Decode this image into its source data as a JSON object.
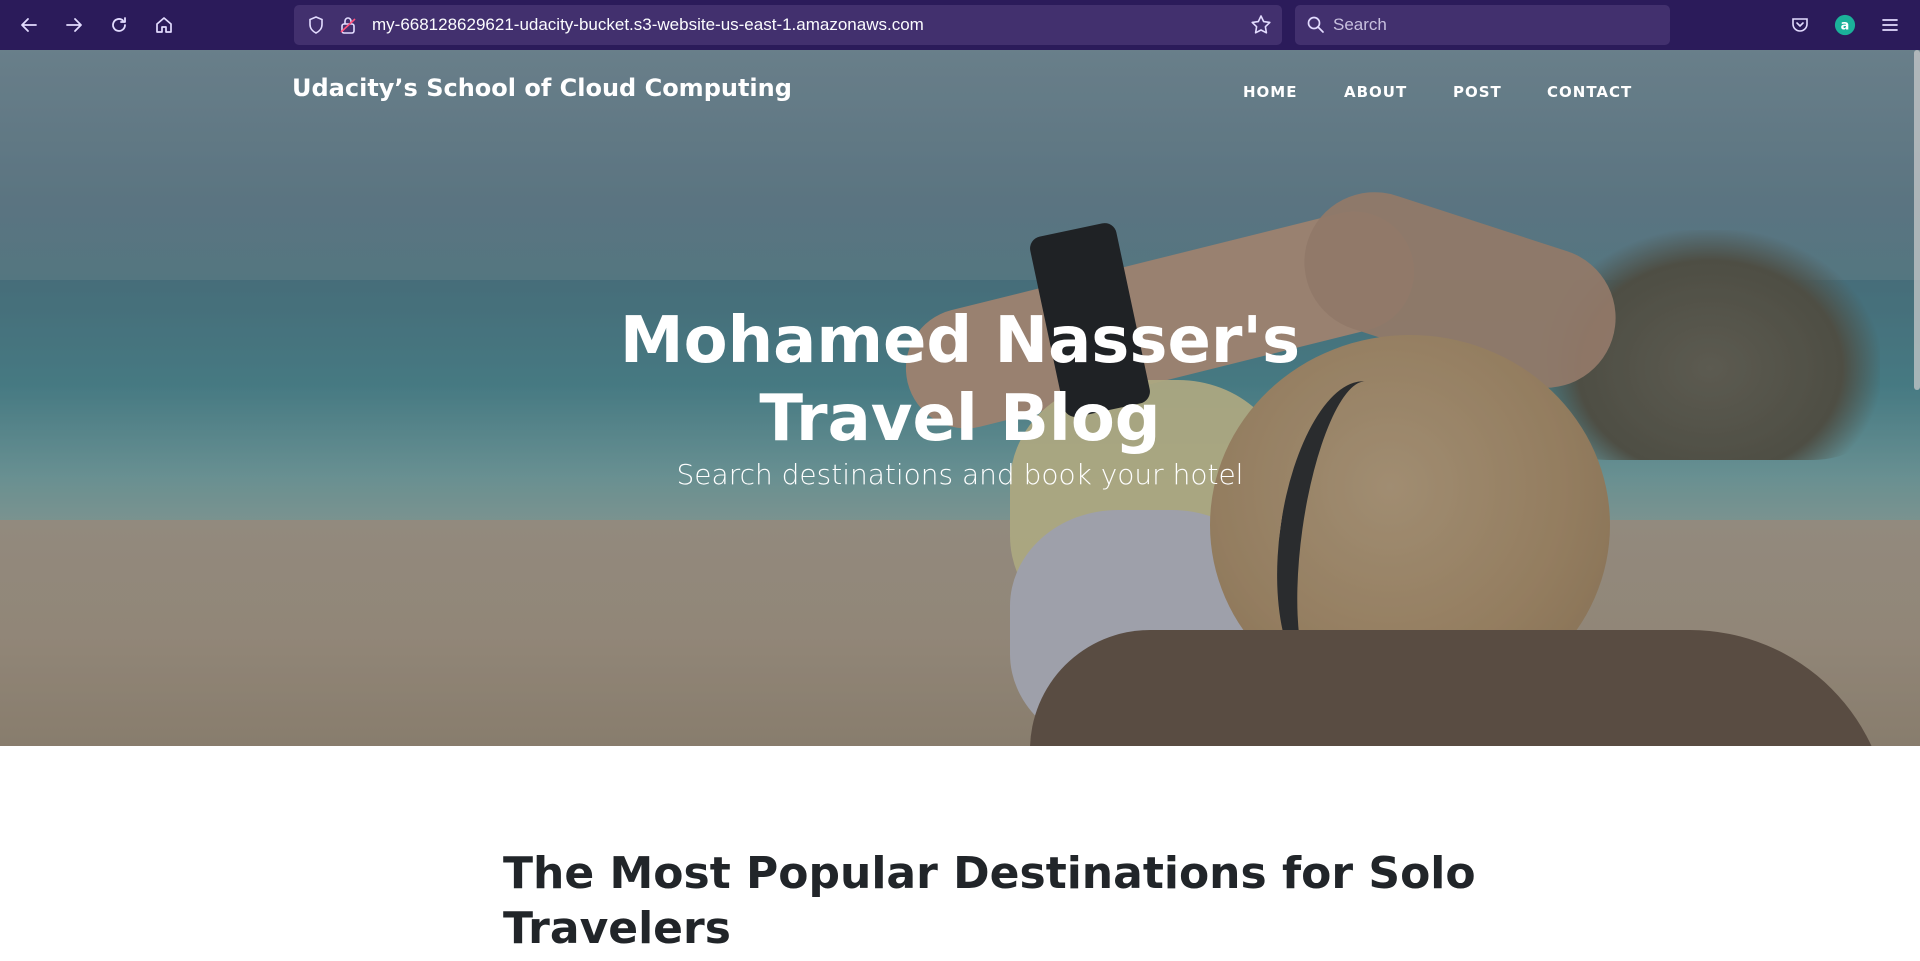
{
  "browser": {
    "url": "my-668128629621-udacity-bucket.s3-website-us-east-1.amazonaws.com",
    "search_placeholder": "Search",
    "icons": [
      "back-icon",
      "forward-icon",
      "reload-icon",
      "home-icon",
      "shield-icon",
      "lock-icon",
      "bookmark-star-icon",
      "search-icon",
      "pocket-icon",
      "extension-icon",
      "menu-icon"
    ],
    "colors": {
      "toolbar": "#2b1b5a",
      "field": "#42306e",
      "icon": "#e3dcff"
    }
  },
  "site": {
    "brand": "Udacity’s School of Cloud Computing",
    "nav": [
      {
        "label": "HOME"
      },
      {
        "label": "ABOUT"
      },
      {
        "label": "POST"
      },
      {
        "label": "CONTACT"
      }
    ]
  },
  "hero": {
    "title": "Mohamed Nasser's Travel Blog",
    "subtitle": "Search destinations and book your hotel"
  },
  "article": {
    "title": "The Most Popular Destinations for Solo Travelers"
  }
}
